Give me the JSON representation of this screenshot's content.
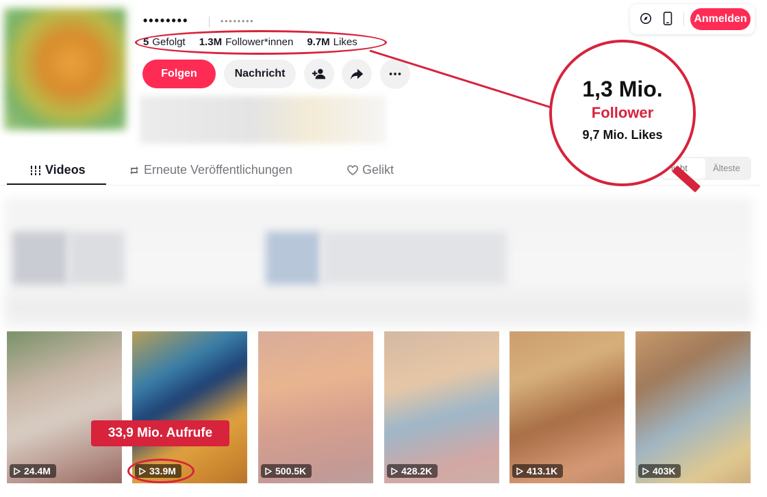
{
  "profile": {
    "username": "••••••••",
    "nickname": "••••••••",
    "stats": {
      "following_count": "5",
      "following_label": "Gefolgt",
      "followers_count": "1.3M",
      "followers_label": "Follower*innen",
      "likes_count": "9.7M",
      "likes_label": "Likes"
    },
    "actions": {
      "follow_label": "Folgen",
      "message_label": "Nachricht",
      "icons": [
        "add-user-icon",
        "share-icon",
        "more-icon"
      ]
    }
  },
  "header": {
    "icons": [
      "compass-icon",
      "mobile-icon"
    ],
    "login_label": "Anmelden"
  },
  "tabs": [
    {
      "label": "Videos",
      "icon": "grid-icon",
      "active": true
    },
    {
      "label": "Erneute Veröffentlichungen",
      "icon": "repost-icon",
      "active": false
    },
    {
      "label": "Gelikt",
      "icon": "heart-icon",
      "active": false
    }
  ],
  "sort": {
    "options": [
      "Beliebt",
      "Älteste"
    ],
    "visible_partial": "liebt",
    "selected": "Beliebt"
  },
  "videos": [
    {
      "views": "24.4M"
    },
    {
      "views": "33.9M"
    },
    {
      "views": "500.5K"
    },
    {
      "views": "428.2K"
    },
    {
      "views": "413.1K"
    },
    {
      "views": "403K"
    }
  ],
  "annotations": {
    "magnifier_followers": "1,3 Mio.",
    "magnifier_follower_label": "Follower",
    "magnifier_likes": "9,7 Mio. Likes",
    "views_callout": "33,9 Mio. Aufrufe",
    "accent_color": "#d7233c"
  },
  "colors": {
    "brand": "#fe2c55",
    "text": "#161823",
    "muted": "#75767c"
  }
}
